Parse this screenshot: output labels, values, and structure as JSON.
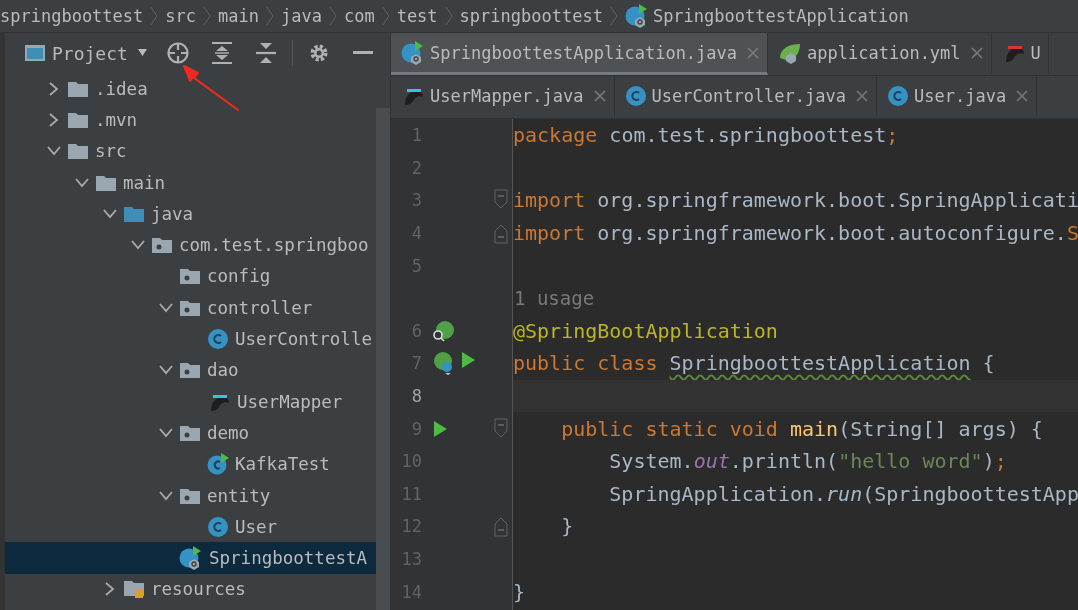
{
  "breadcrumbs": [
    {
      "label": "springboottest",
      "kind": "plain"
    },
    {
      "label": "src",
      "kind": "plain"
    },
    {
      "label": "main",
      "kind": "plain"
    },
    {
      "label": "java",
      "kind": "plain"
    },
    {
      "label": "com",
      "kind": "plain"
    },
    {
      "label": "test",
      "kind": "plain"
    },
    {
      "label": "springboottest",
      "kind": "plain"
    },
    {
      "label": "SpringboottestApplication",
      "kind": "spring"
    }
  ],
  "project_panel": {
    "title": "Project"
  },
  "tree": [
    {
      "label": ".idea",
      "kind": "folder",
      "expanded": false,
      "selected": false
    },
    {
      "label": ".mvn",
      "kind": "folder",
      "expanded": false,
      "selected": false
    },
    {
      "label": "src",
      "kind": "folder",
      "expanded": true,
      "selected": false,
      "children": [
        {
          "label": "main",
          "kind": "folder",
          "expanded": true,
          "selected": false,
          "children": [
            {
              "label": "java",
              "kind": "source",
              "expanded": true,
              "selected": false,
              "children": [
                {
                  "label": "com.test.springboo",
                  "kind": "package",
                  "expanded": true,
                  "selected": false,
                  "children": [
                    {
                      "label": "config",
                      "kind": "package",
                      "selected": false
                    },
                    {
                      "label": "controller",
                      "kind": "package",
                      "expanded": true,
                      "selected": false,
                      "children": [
                        {
                          "label": "UserControlle",
                          "kind": "class",
                          "selected": false
                        }
                      ]
                    },
                    {
                      "label": "dao",
                      "kind": "package",
                      "expanded": true,
                      "selected": false,
                      "children": [
                        {
                          "label": "UserMapper",
                          "kind": "mapper",
                          "selected": false
                        }
                      ]
                    },
                    {
                      "label": "demo",
                      "kind": "package",
                      "expanded": true,
                      "selected": false,
                      "children": [
                        {
                          "label": "KafkaTest",
                          "kind": "runner",
                          "selected": false
                        }
                      ]
                    },
                    {
                      "label": "entity",
                      "kind": "package",
                      "expanded": true,
                      "selected": false,
                      "children": [
                        {
                          "label": "User",
                          "kind": "class",
                          "selected": false
                        }
                      ]
                    },
                    {
                      "label": "SpringboottestA",
                      "kind": "spring",
                      "selected": true
                    }
                  ]
                }
              ]
            },
            {
              "label": "resources",
              "kind": "resources",
              "expanded": false,
              "selected": false
            }
          ]
        }
      ]
    }
  ],
  "tab_rows": [
    [
      {
        "label": "SpringboottestApplication.java",
        "kind": "spring",
        "selected": true,
        "closable": true
      },
      {
        "label": "application.yml",
        "kind": "leaf",
        "selected": false,
        "closable": true
      },
      {
        "label": "U",
        "kind": "mybatis",
        "selected": false,
        "closable": false
      }
    ],
    [
      {
        "label": "UserMapper.java",
        "kind": "mapper",
        "selected": false,
        "closable": true
      },
      {
        "label": "UserController.java",
        "kind": "class",
        "selected": false,
        "closable": true
      },
      {
        "label": "User.java",
        "kind": "class",
        "selected": false,
        "closable": true
      }
    ]
  ],
  "editor_lines": [
    {
      "kind": "code",
      "number": "1",
      "current": false,
      "tokens": [
        {
          "kind": "kw",
          "text": "package"
        },
        {
          "kind": "plain",
          "text": " com.test.springboottest"
        },
        {
          "kind": "kw",
          "text": ";"
        }
      ]
    },
    {
      "kind": "code",
      "number": "2",
      "current": false
    },
    {
      "kind": "code",
      "number": "3",
      "current": false,
      "fold_open": true,
      "tokens": [
        {
          "kind": "kw",
          "text": "import"
        },
        {
          "kind": "plain",
          "text": " org.springframework.boot.SpringApplicati"
        }
      ]
    },
    {
      "kind": "code",
      "number": "4",
      "current": false,
      "fold_close": true,
      "tokens": [
        {
          "kind": "kw",
          "text": "import"
        },
        {
          "kind": "plain",
          "text": " org.springframework.boot.autoconfigure."
        },
        {
          "kind": "kw",
          "text": "S"
        }
      ]
    },
    {
      "kind": "code",
      "number": "5",
      "current": false
    },
    {
      "kind": "inlay",
      "text": "1 usage"
    },
    {
      "kind": "code",
      "number": "6",
      "current": false,
      "bean_search": true,
      "tokens": [
        {
          "kind": "ann",
          "text": "@SpringBootApplication"
        }
      ]
    },
    {
      "kind": "code",
      "number": "7",
      "current": false,
      "spring_bean": true,
      "runnable": true,
      "tokens": [
        {
          "kind": "kw",
          "text": "public class "
        },
        {
          "kind": "typo",
          "text": "SpringboottestApplication"
        },
        {
          "kind": "plain",
          "text": " {"
        }
      ]
    },
    {
      "kind": "code",
      "number": "8",
      "current": true
    },
    {
      "kind": "code",
      "number": "9",
      "current": false,
      "runnable": true,
      "fold_open": true,
      "tokens": [
        {
          "kind": "kw",
          "text": "    public static void "
        },
        {
          "kind": "method",
          "text": "main"
        },
        {
          "kind": "plain",
          "text": "(String[] args) {"
        }
      ]
    },
    {
      "kind": "code",
      "number": "10",
      "current": false,
      "tokens": [
        {
          "kind": "plain",
          "text": "        System."
        },
        {
          "kind": "field",
          "text": "out"
        },
        {
          "kind": "plain",
          "text": ".println("
        },
        {
          "kind": "str",
          "text": "\"hello word\""
        },
        {
          "kind": "plain",
          "text": ")"
        },
        {
          "kind": "kw",
          "text": ";"
        }
      ]
    },
    {
      "kind": "code",
      "number": "11",
      "current": false,
      "tokens": [
        {
          "kind": "plain",
          "text": "        SpringApplication."
        },
        {
          "kind": "static",
          "text": "run"
        },
        {
          "kind": "plain",
          "text": "(SpringboottestApp"
        }
      ]
    },
    {
      "kind": "code",
      "number": "12",
      "current": false,
      "fold_close": true,
      "tokens": [
        {
          "kind": "plain",
          "text": "    }"
        }
      ]
    },
    {
      "kind": "code",
      "number": "13",
      "current": false
    },
    {
      "kind": "code",
      "number": "14",
      "current": false,
      "tokens": [
        {
          "kind": "plain",
          "text": "}"
        }
      ]
    }
  ]
}
